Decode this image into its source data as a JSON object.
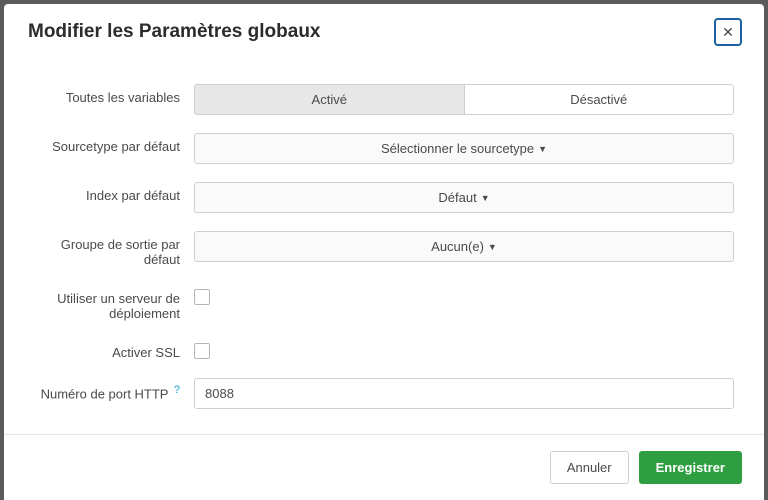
{
  "modal": {
    "title": "Modifier les Paramètres globaux",
    "labels": {
      "all_vars": "Toutes les variables",
      "sourcetype": "Sourcetype par défaut",
      "index": "Index par défaut",
      "output_group": "Groupe de sortie par défaut",
      "use_deploy": "Utiliser un serveur de déploiement",
      "enable_ssl": "Activer SSL",
      "http_port": "Numéro de port HTTP",
      "help_mark": "?"
    },
    "toggle": {
      "on": "Activé",
      "off": "Désactivé"
    },
    "dropdowns": {
      "sourcetype": "Sélectionner le sourcetype",
      "index": "Défaut",
      "output_group": "Aucun(e)"
    },
    "http_port_value": "8088",
    "footer": {
      "cancel": "Annuler",
      "save": "Enregistrer"
    }
  }
}
